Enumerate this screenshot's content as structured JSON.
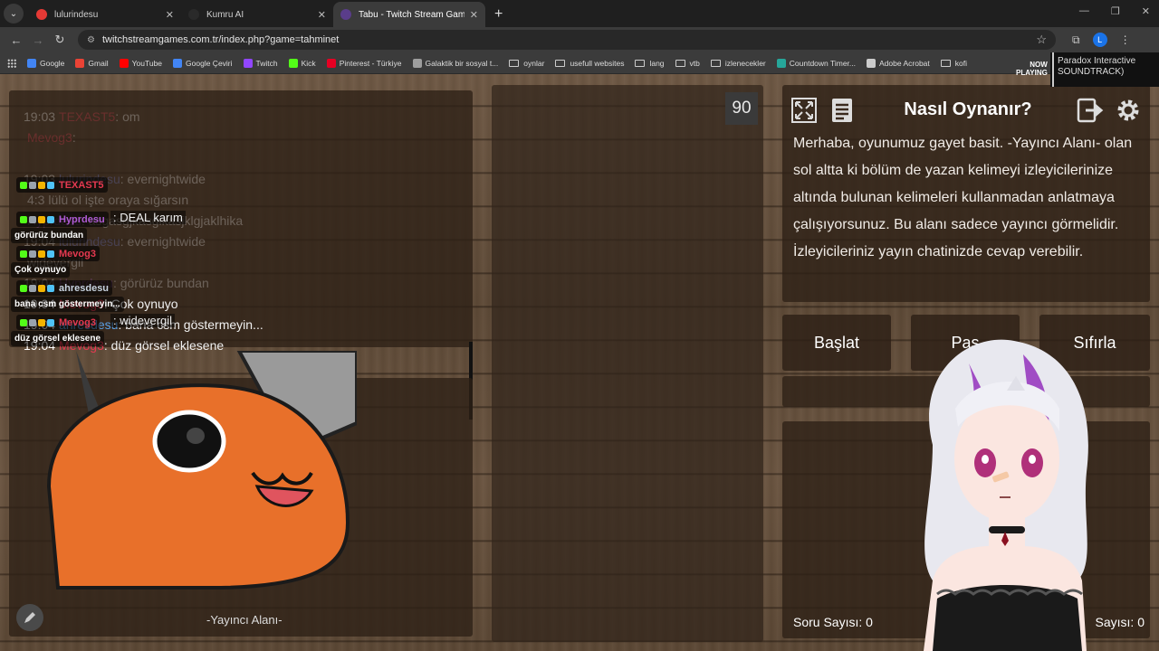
{
  "browser": {
    "tabs": [
      {
        "title": "lulurindesu",
        "color": "#e53935",
        "active": false
      },
      {
        "title": "Kumru AI",
        "color": "#2a2a2a",
        "active": false
      },
      {
        "title": "Tabu - Twitch Stream Games",
        "color": "#3b3b3b",
        "active": true
      }
    ],
    "url": "twitchstreamgames.com.tr/index.php?game=tahminet",
    "profile_initial": "L",
    "bookmarks": [
      {
        "label": "Google",
        "color": "#4285f4"
      },
      {
        "label": "Gmail",
        "color": "#ea4335"
      },
      {
        "label": "YouTube",
        "color": "#ff0000"
      },
      {
        "label": "Google Çeviri",
        "color": "#4285f4"
      },
      {
        "label": "Twitch",
        "color": "#9146ff"
      },
      {
        "label": "Kick",
        "color": "#53fc18"
      },
      {
        "label": "Pinterest - Türkiye",
        "color": "#e60023"
      },
      {
        "label": "Galaktik bir sosyal t...",
        "color": "#9e9e9e"
      },
      {
        "label": "oynlar",
        "folder": true
      },
      {
        "label": "usefull websites",
        "folder": true
      },
      {
        "label": "lang",
        "folder": true
      },
      {
        "label": "vtb",
        "folder": true
      },
      {
        "label": "izlenecekler",
        "folder": true
      },
      {
        "label": "Countdown Timer...",
        "color": "#26a69a"
      },
      {
        "label": "Adobe Acrobat",
        "color": "#cccccc"
      },
      {
        "label": "kofi",
        "folder": true
      }
    ]
  },
  "now_playing": {
    "label_1": "NOW",
    "label_2": "PLAYING",
    "title_1": "Paradox Interactive",
    "title_2": "SOUNDTRACK)"
  },
  "game": {
    "timer": "90",
    "how_to_play": {
      "title": "Nasıl Oynanır?",
      "text": "Merhaba, oyunumuz gayet basit. -Yayıncı Alanı- olan sol altta ki bölüm de yazan kelimeyi izleyicilerinize altında bulunan kelimeleri kullanmadan anlatmaya çalışıyorsunuz. Bu alanı sadece yayıncı görmelidir. İzleyicileriniz yayın chatinizde cevap verebilir."
    },
    "buttons": {
      "start": "Başlat",
      "pass": "Pas",
      "reset": "Sıfırla"
    },
    "counter_left": "Soru Sayısı: 0",
    "counter_right": "Sayısı: 0",
    "streamer_area": "-Yayıncı Alanı-"
  },
  "chat": {
    "lines": [
      {
        "time": "19:03",
        "user": "TEXAST5",
        "color": "#e53950",
        "msg": "om",
        "faded": true
      },
      {
        "time": "",
        "user": "Mevog3",
        "color": "#e53950",
        "msg": "",
        "faded": true
      },
      {
        "time": "",
        "user": "",
        "color": "#fff",
        "msg": "",
        "faded": true
      },
      {
        "time": "19:03",
        "user": "lulurindesu",
        "color": "#6f7cd6",
        "msg": "evernightwide",
        "faded": true
      },
      {
        "time": "",
        "user": "",
        "color": "#fff",
        "msg": "4:3 lülü ol işte oraya sığarsın",
        "faded": true
      },
      {
        "time": "",
        "user": "Hyprdesu",
        "color": "#b05bd6",
        "msg": "asgasgjkasgikasjklgjaklhika",
        "faded": true
      },
      {
        "time": "19:04",
        "user": "lulurindesu",
        "color": "#6f7cd6",
        "msg": "evernightwide",
        "faded": true
      },
      {
        "time": "",
        "user": "",
        "color": "#fff",
        "msg": "widevergil",
        "faded": true
      },
      {
        "time": "19:04",
        "user": "Hyprdesu",
        "color": "#b05bd6",
        "msg": "görürüz bundan",
        "faded": true
      },
      {
        "time": "19:04",
        "user": "Mevog3",
        "color": "#e53950",
        "msg": "Çok oynuyo",
        "faded": false
      },
      {
        "time": "19:04",
        "user": "ahresdesu",
        "color": "#5aa0e6",
        "msg": "bana csm göstermeyin...",
        "faded": false
      },
      {
        "time": "19:04",
        "user": "Mevog3",
        "color": "#e53950",
        "msg": "düz görsel eklesene",
        "faded": false
      }
    ],
    "overlay": [
      {
        "user": "TEXAST5",
        "color": "#e53950",
        "msg": ""
      },
      {
        "user": "Hyprdesu",
        "color": "#b05bd6",
        "msg": ": DEAL karım",
        "msg2": "görürüz bundan"
      },
      {
        "user": "Mevog3",
        "color": "#e53950",
        "msg": "",
        "msg2": "Çok oynuyo"
      },
      {
        "user": "ahresdesu",
        "color": "#c9d4e0",
        "msg": "",
        "msg2": "bana csm göstermeyin..."
      },
      {
        "user": "Mevog3",
        "color": "#e53950",
        "msg": ": widevergil",
        "msg2": "düz görsel eklesene"
      }
    ]
  }
}
